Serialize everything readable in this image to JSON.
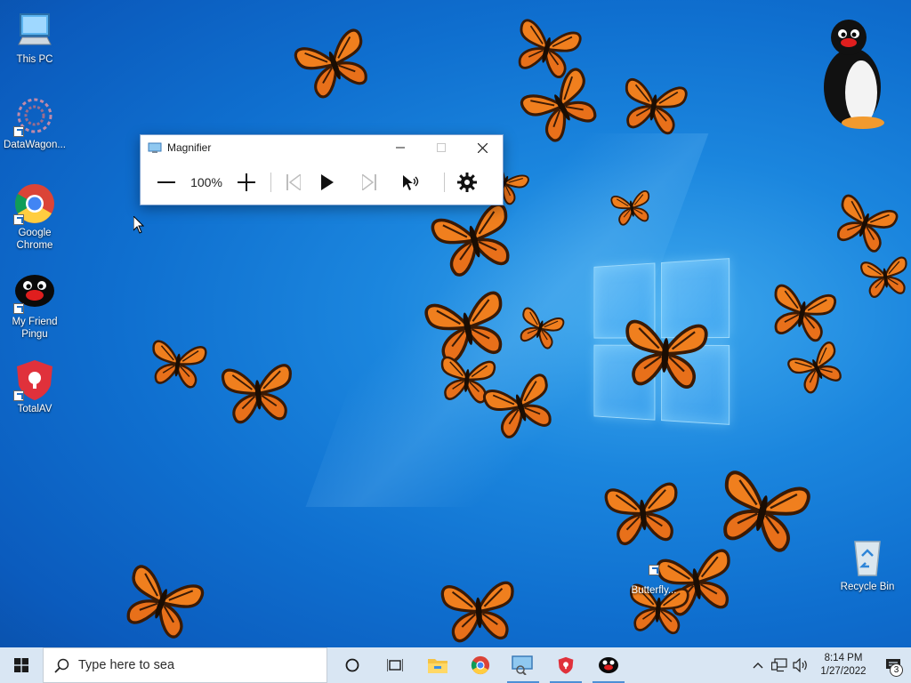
{
  "desktop": {
    "icons": [
      {
        "label": "This PC",
        "icon": "this-pc-icon"
      },
      {
        "label": "DataWagon...",
        "icon": "datawagon-icon"
      },
      {
        "label": "Google Chrome",
        "icon": "chrome-icon"
      },
      {
        "label": "My Friend Pingu",
        "icon": "pingu-icon"
      },
      {
        "label": "TotalAV",
        "icon": "totalav-icon"
      }
    ],
    "recycle_bin": {
      "label": "Recycle Bin",
      "icon": "recycle-bin-icon"
    },
    "butterfly_shortcut": {
      "label": "Butterfly...",
      "icon": "butterfly-shortcut-icon"
    }
  },
  "magnifier": {
    "title": "Magnifier",
    "zoom_level": "100%",
    "buttons": {
      "zoom_out": "zoom-out-icon",
      "zoom_in": "zoom-in-icon",
      "previous": "skip-previous-icon",
      "play": "play-icon",
      "next": "skip-next-icon",
      "read_from_here": "read-from-here-icon",
      "settings": "gear-icon"
    }
  },
  "taskbar": {
    "search_placeholder": "Type here to search",
    "search_visible_text": "Type here to sea",
    "apps": [
      "cortana-icon",
      "task-view-icon",
      "file-explorer-icon",
      "chrome-icon",
      "magnifier-icon",
      "totalav-icon",
      "pingu-icon"
    ],
    "tray": {
      "time": "8:14 PM",
      "date": "1/27/2022",
      "notification_count": "3"
    }
  },
  "colors": {
    "desktop_blue": "#1b86de",
    "taskbar_bg": "#d9e6f3",
    "butterfly_orange": "#f07f1e"
  }
}
